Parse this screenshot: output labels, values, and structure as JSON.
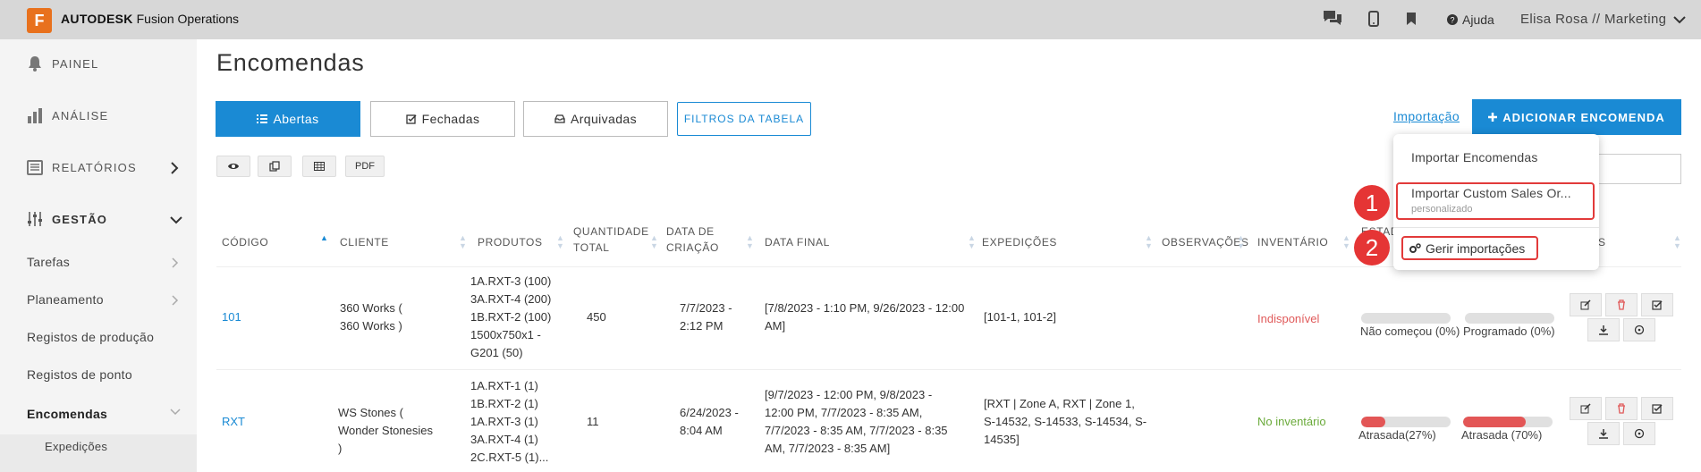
{
  "app": {
    "logo_letter": "F",
    "brand_bold": "AUTODESK",
    "brand_rest": " Fusion Operations"
  },
  "topbar": {
    "help_label": "Ajuda",
    "user_label": "Elisa Rosa // Marketing"
  },
  "sidebar": {
    "main": [
      {
        "label": "PAINEL",
        "icon": "bell-icon"
      },
      {
        "label": "ANÁLISE",
        "icon": "bar-chart-icon"
      },
      {
        "label": "RELATÓRIOS",
        "icon": "report-icon"
      },
      {
        "label": "GESTÃO",
        "icon": "sliders-icon"
      }
    ],
    "sub": [
      "Tarefas",
      "Planeamento",
      "Registos de produção",
      "Registos de ponto",
      "Encomendas",
      "Expedições"
    ]
  },
  "page": {
    "title": "Encomendas"
  },
  "tabs": {
    "abertas": "Abertas",
    "fechadas": "Fechadas",
    "arquivadas": "Arquivadas",
    "filtros": "FILTROS DA TABELA"
  },
  "toolbar": {
    "importacao": "Importação",
    "add": "ADICIONAR ENCOMENDA",
    "pdf": "PDF"
  },
  "dropdown": {
    "item1": "Importar Encomendas",
    "item2": "Importar Custom Sales Or...",
    "item2_sub": "personalizado",
    "item3": "Gerir importações",
    "badge1": "1",
    "badge2": "2"
  },
  "table": {
    "headers": {
      "codigo": "CÓDIGO",
      "cliente": "CLIENTE",
      "produtos": "PRODUTOS",
      "qtd1": "QUANTIDADE",
      "qtd2": "TOTAL",
      "data1": "DATA DE",
      "data2": "CRIAÇÃO",
      "final": "DATA FINAL",
      "exped": "EXPEDIÇÕES",
      "obs": "OBSERVAÇÕES",
      "inv": "INVENTÁRIO",
      "estado_partial": "ESTAD",
      "estado_partial2": "E",
      "last_partial": "S"
    },
    "rows": [
      {
        "codigo": "101",
        "cliente": [
          "360 Works (",
          "360 Works )"
        ],
        "produtos": [
          "1A.RXT-3 (100)",
          "3A.RXT-4 (200)",
          "1B.RXT-2 (100)",
          "1500x750x1 -",
          "G201 (50)"
        ],
        "quantidade": "450",
        "criacao": [
          "7/7/2023 -",
          "2:12 PM"
        ],
        "final": [
          "[7/8/2023 - 1:10 PM, 9/26/2023 - 12:00",
          "AM]"
        ],
        "expedicoes": [
          "[101-1, 101-2]"
        ],
        "inventario": "Indisponível",
        "prog1_label": "Não começou (0%)",
        "prog1_value": 0,
        "prog2_label": "Programado (0%)",
        "prog2_value": 0
      },
      {
        "codigo": "RXT",
        "cliente": [
          "WS Stones (",
          "Wonder Stonesies",
          ")"
        ],
        "produtos": [
          "1A.RXT-1 (1)",
          "1B.RXT-2 (1)",
          "1A.RXT-3 (1)",
          "3A.RXT-4 (1)",
          "2C.RXT-5 (1)..."
        ],
        "quantidade": "11",
        "criacao": [
          "6/24/2023 -",
          "8:04 AM"
        ],
        "final": [
          "[9/7/2023 - 12:00 PM, 9/8/2023 -",
          "12:00 PM, 7/7/2023 - 8:35 AM,",
          "7/7/2023 - 8:35 AM, 7/7/2023 - 8:35",
          "AM, 7/7/2023 - 8:35 AM]"
        ],
        "expedicoes": [
          "[RXT | Zone A, RXT | Zone 1,",
          "S-14532, S-14533, S-14534, S-",
          "14535]"
        ],
        "inventario": "No inventário",
        "prog1_label": "Atrasada(27%)",
        "prog1_value": 27,
        "prog2_label": "Atrasada (70%)",
        "prog2_value": 70
      }
    ]
  },
  "colors": {
    "primary": "#1a8ad4",
    "danger": "#e53535",
    "brand": "#e8711d"
  }
}
